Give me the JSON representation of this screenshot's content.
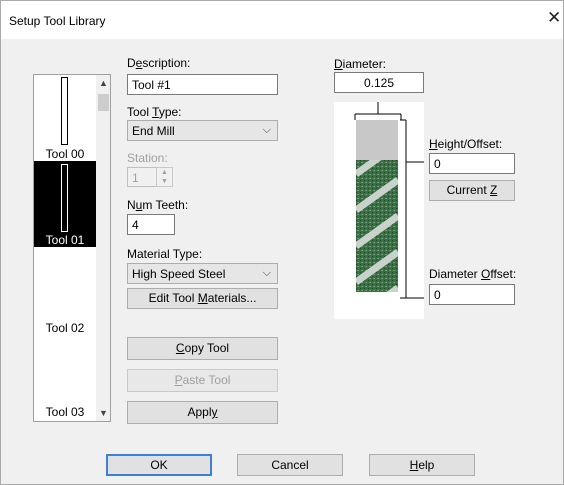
{
  "window": {
    "title": "Setup Tool Library",
    "close_icon": "close-icon"
  },
  "tool_list": {
    "items": [
      {
        "label": "Tool 00",
        "selected": false
      },
      {
        "label": "Tool 01",
        "selected": true
      },
      {
        "label": "Tool 02",
        "selected": false
      },
      {
        "label": "Tool 03",
        "selected": false
      }
    ]
  },
  "description": {
    "label_pre": "D",
    "label_acc": "e",
    "label_post": "scription:",
    "value": "Tool #1"
  },
  "tool_type": {
    "label_pre": "Tool ",
    "label_acc": "T",
    "label_post": "ype:",
    "value": "End Mill"
  },
  "station": {
    "label": "Station:",
    "value": "1"
  },
  "num_teeth": {
    "label_pre": "N",
    "label_acc": "u",
    "label_post": "m Teeth:",
    "value": "4"
  },
  "material_type": {
    "label": "Material Type:",
    "value": "High Speed Steel"
  },
  "buttons": {
    "edit_materials_pre": "Edit Tool ",
    "edit_materials_acc": "M",
    "edit_materials_post": "aterials...",
    "copy_pre": "",
    "copy_acc": "C",
    "copy_post": "opy Tool",
    "paste_pre": "",
    "paste_acc": "P",
    "paste_post": "aste Tool",
    "apply_pre": "Appl",
    "apply_acc": "y",
    "apply_post": "",
    "current_z_pre": "Current ",
    "current_z_acc": "Z",
    "current_z_post": "",
    "ok": "OK",
    "cancel": "Cancel",
    "help_pre": "",
    "help_acc": "H",
    "help_post": "elp"
  },
  "diameter": {
    "label_pre": "",
    "label_acc": "D",
    "label_post": "iameter:",
    "value": "0.125"
  },
  "height_offset": {
    "label_pre": "",
    "label_acc": "H",
    "label_post": "eight/Offset:",
    "value": "0"
  },
  "diameter_offset": {
    "label_pre": "Diameter ",
    "label_acc": "O",
    "label_post": "ffset:",
    "value": "0"
  },
  "colors": {
    "accent": "#3c7fd6",
    "flute": "#3c6e45",
    "shank": "#c8c8c8"
  }
}
